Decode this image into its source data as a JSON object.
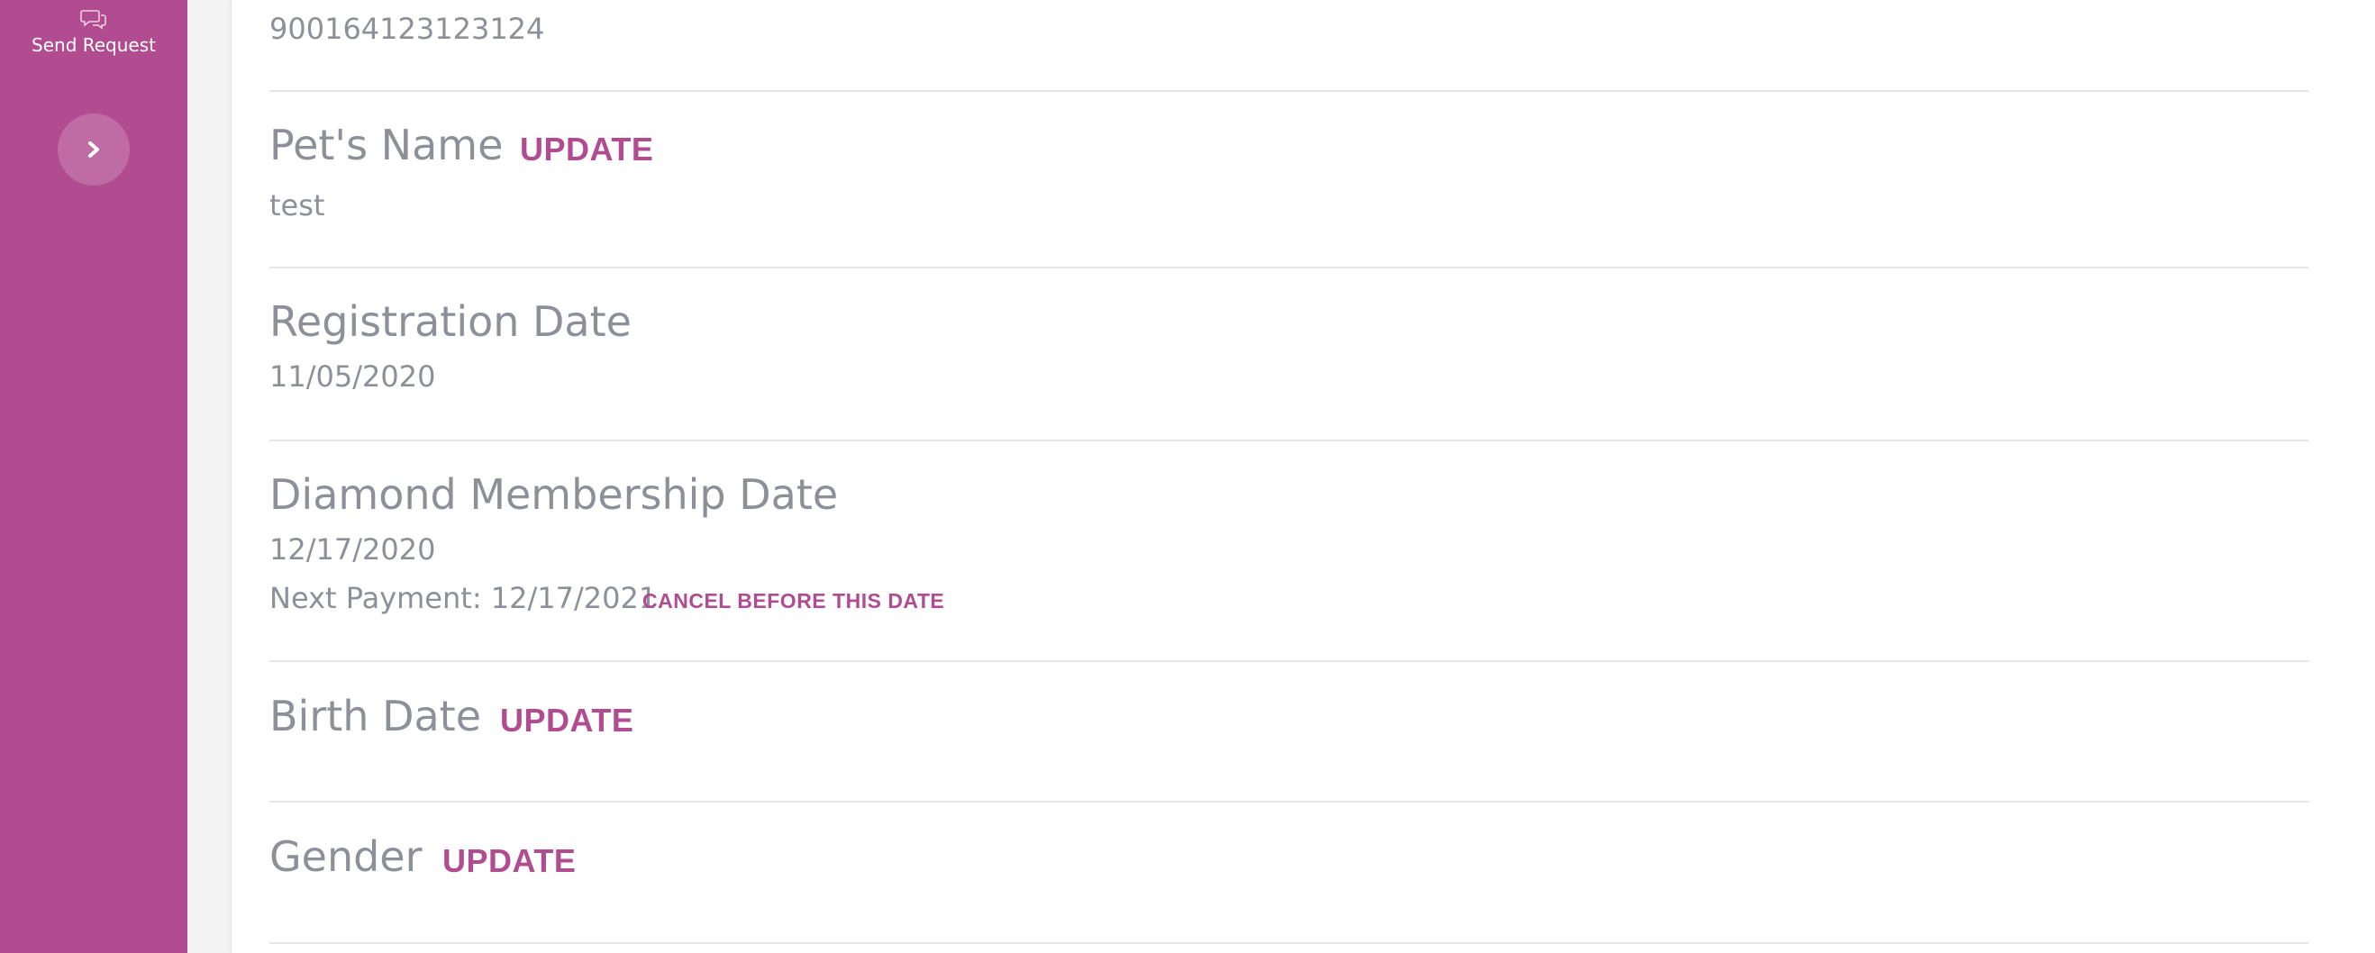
{
  "sidebar": {
    "send_request_label": "Send Request",
    "send_request_icon": "chat-bubbles-icon",
    "expand_icon": "chevron-right-icon",
    "color": "#b04c8f"
  },
  "fields": {
    "microchip_value": "900164123123124",
    "pet_name": {
      "label": "Pet's Name",
      "action": "UPDATE",
      "value": "test"
    },
    "registration_date": {
      "label": "Registration Date",
      "value": "11/05/2020"
    },
    "diamond_membership": {
      "label": "Diamond Membership Date",
      "value": "12/17/2020",
      "next_payment": "Next Payment: 12/17/2021",
      "cancel_action": "CANCEL BEFORE THIS DATE"
    },
    "birth_date": {
      "label": "Birth Date",
      "action": "UPDATE"
    },
    "gender": {
      "label": "Gender",
      "action": "UPDATE"
    }
  },
  "colors": {
    "accent": "#b04c8f",
    "text_muted": "#8d9099",
    "divider": "#e6e6e6"
  }
}
